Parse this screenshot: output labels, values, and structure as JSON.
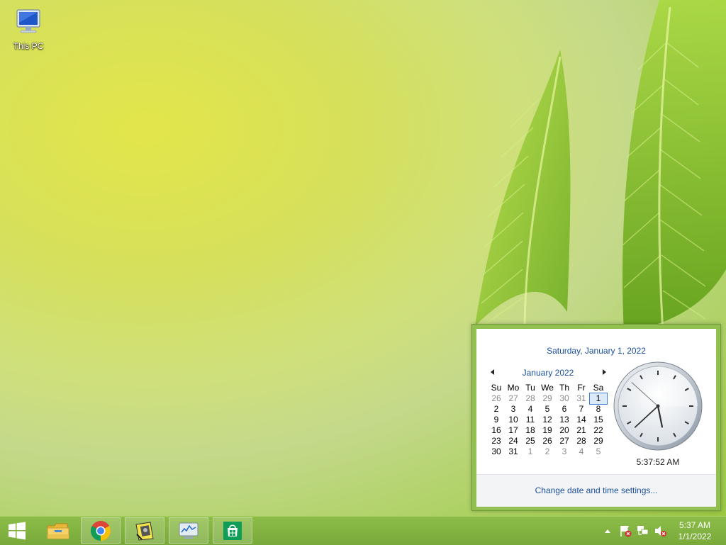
{
  "desktop": {
    "icons": [
      {
        "label": "This PC",
        "icon": "this-pc-icon"
      }
    ]
  },
  "calendar_flyout": {
    "long_date": "Saturday, January 1, 2022",
    "month_label": "January 2022",
    "weekdays": [
      "Su",
      "Mo",
      "Tu",
      "We",
      "Th",
      "Fr",
      "Sa"
    ],
    "weeks": [
      [
        "26",
        "27",
        "28",
        "29",
        "30",
        "31",
        "1"
      ],
      [
        "2",
        "3",
        "4",
        "5",
        "6",
        "7",
        "8"
      ],
      [
        "9",
        "10",
        "11",
        "12",
        "13",
        "14",
        "15"
      ],
      [
        "16",
        "17",
        "18",
        "19",
        "20",
        "21",
        "22"
      ],
      [
        "23",
        "24",
        "25",
        "26",
        "27",
        "28",
        "29"
      ],
      [
        "30",
        "31",
        "1",
        "2",
        "3",
        "4",
        "5"
      ]
    ],
    "muted_days": [
      [
        0,
        0
      ],
      [
        0,
        1
      ],
      [
        0,
        2
      ],
      [
        0,
        3
      ],
      [
        0,
        4
      ],
      [
        0,
        5
      ],
      [
        5,
        2
      ],
      [
        5,
        3
      ],
      [
        5,
        4
      ],
      [
        5,
        5
      ],
      [
        5,
        6
      ]
    ],
    "today": [
      0,
      6
    ],
    "digital_time": "5:37:52 AM",
    "clock": {
      "hours": 5,
      "minutes": 37,
      "seconds": 52
    },
    "settings_link": "Change date and time settings..."
  },
  "taskbar": {
    "start": "windows-start-icon",
    "pinned": [
      {
        "name": "file-explorer",
        "icon": "file-explorer-icon",
        "running": false
      },
      {
        "name": "chrome",
        "icon": "chrome-icon",
        "running": true
      },
      {
        "name": "app",
        "icon": "app-icon",
        "running": true
      },
      {
        "name": "resource-monitor",
        "icon": "resource-monitor-icon",
        "running": true
      },
      {
        "name": "store",
        "icon": "store-icon",
        "running": true
      }
    ],
    "tray": {
      "icons": [
        "show-hidden-icons-icon",
        "action-center-flag-icon",
        "network-icon",
        "volume-muted-icon"
      ],
      "time": "5:37 AM",
      "date": "1/1/2022"
    }
  },
  "colors": {
    "taskbar": "#82b340",
    "flyout_border": "#92c050",
    "link_blue": "#1a4f9c"
  }
}
